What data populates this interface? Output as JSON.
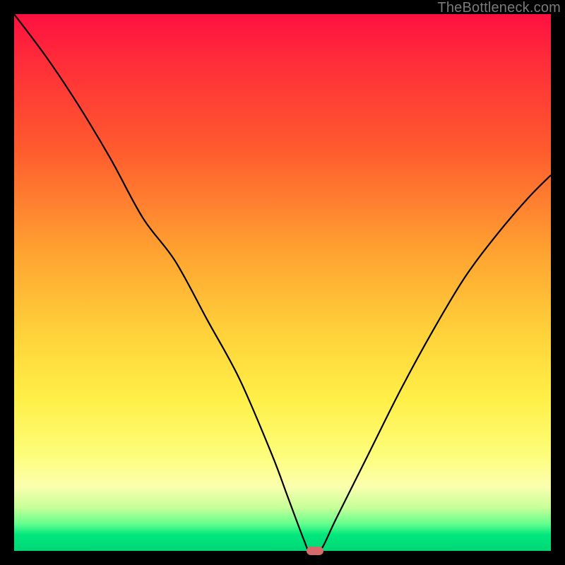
{
  "watermark": "TheBottleneck.com",
  "colors": {
    "frame": "#000000",
    "curve": "#000000",
    "marker": "#d46a6a",
    "watermark": "#7b7b7b"
  },
  "chart_data": {
    "type": "line",
    "title": "",
    "xlabel": "",
    "ylabel": "",
    "xlim": [
      0,
      100
    ],
    "ylim": [
      0,
      100
    ],
    "grid": false,
    "legend": false,
    "series": [
      {
        "name": "bottleneck-curve",
        "x": [
          0,
          6,
          12,
          18,
          24,
          30,
          36,
          42,
          48,
          51,
          54,
          55,
          57,
          60,
          66,
          72,
          78,
          84,
          90,
          96,
          100
        ],
        "values": [
          100,
          92,
          83,
          73,
          62,
          54,
          43,
          32,
          18,
          10,
          2,
          0,
          0,
          6,
          18,
          30,
          41,
          51,
          59,
          66,
          70
        ]
      }
    ],
    "marker": {
      "x": 56,
      "y": 0
    },
    "background_gradient": [
      {
        "stop": 0,
        "color": "#ff1041"
      },
      {
        "stop": 25,
        "color": "#ff5a2e"
      },
      {
        "stop": 60,
        "color": "#ffd33a"
      },
      {
        "stop": 88,
        "color": "#fbffae"
      },
      {
        "stop": 100,
        "color": "#00d776"
      }
    ]
  }
}
